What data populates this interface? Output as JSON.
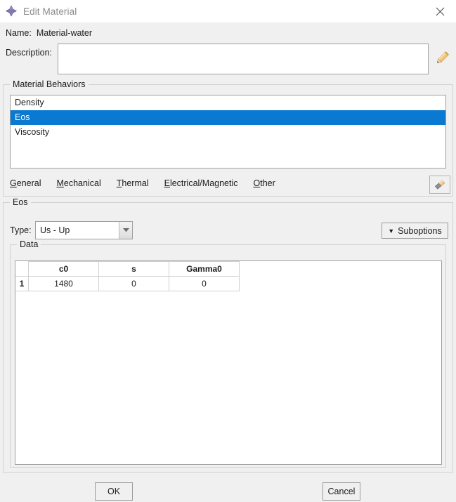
{
  "window": {
    "title": "Edit Material",
    "icon": "abaqus-diamond-icon",
    "close_icon": "close-icon",
    "title_color": "#8a8a8a"
  },
  "name_field": {
    "label": "Name:",
    "value": "Material-water"
  },
  "description_field": {
    "label": "Description:",
    "value": "",
    "placeholder": "",
    "edit_icon": "pencil-icon"
  },
  "material_behaviors": {
    "legend": "Material Behaviors",
    "items": [
      {
        "label": "Density",
        "selected": false
      },
      {
        "label": "Eos",
        "selected": true
      },
      {
        "label": "Viscosity",
        "selected": false
      }
    ],
    "selection_color": "#0a79d1",
    "menu": [
      {
        "label": "General",
        "mnemonic": "G",
        "rest": "eneral"
      },
      {
        "label": "Mechanical",
        "mnemonic": "M",
        "rest": "echanical"
      },
      {
        "label": "Thermal",
        "mnemonic": "T",
        "rest": "hermal"
      },
      {
        "label": "Electrical/Magnetic",
        "mnemonic": "E",
        "rest": "lectrical/Magnetic"
      },
      {
        "label": "Other",
        "mnemonic": "O",
        "rest": "ther"
      }
    ],
    "eraser_icon": "eraser-icon"
  },
  "eos": {
    "legend": "Eos",
    "type_label": "Type:",
    "type_value": "Us - Up",
    "type_options": [
      "Us - Up"
    ],
    "suboptions_label": "Suboptions",
    "suboptions_caret": "▼",
    "data": {
      "legend": "Data",
      "columns": [
        "c0",
        "s",
        "Gamma0"
      ],
      "rows": [
        {
          "index": "1",
          "values": [
            "1480",
            "0",
            "0"
          ]
        }
      ]
    }
  },
  "footer": {
    "ok_label": "OK",
    "cancel_label": "Cancel"
  }
}
